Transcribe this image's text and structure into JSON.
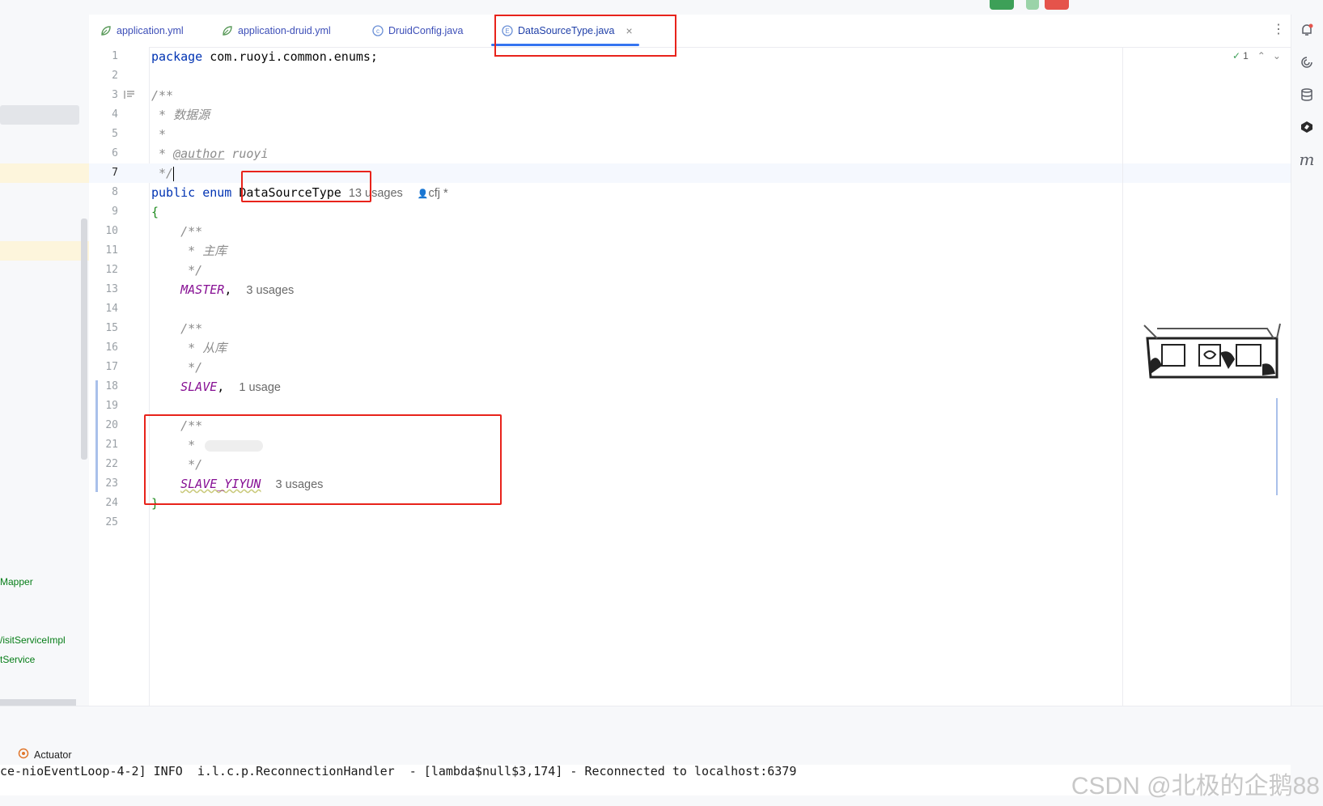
{
  "tabs": [
    {
      "label": "application.yml",
      "icon": "yaml-leaf-icon"
    },
    {
      "label": "application-druid.yml",
      "icon": "yaml-leaf-icon"
    },
    {
      "label": "DruidConfig.java",
      "icon": "class-icon"
    },
    {
      "label": "DataSourceType.java",
      "icon": "enum-icon",
      "active": true,
      "close": "×"
    }
  ],
  "project_tree": [
    "Mapper",
    "/isitServiceImpl",
    "tService"
  ],
  "line_numbers": [
    "1",
    "2",
    "3",
    "4",
    "5",
    "6",
    "7",
    "8",
    "9",
    "10",
    "11",
    "12",
    "13",
    "14",
    "15",
    "16",
    "17",
    "18",
    "19",
    "20",
    "21",
    "22",
    "23",
    "24",
    "25"
  ],
  "code": {
    "l1_kw": "package",
    "l1_rest": " com.ruoyi.common.enums;",
    "l3": "/**",
    "l4": " * 数据源",
    "l5": " *",
    "l6_a": " * ",
    "l6_tag": "@author",
    "l6_b": " ruoyi",
    "l7": " */",
    "l8_kw": "public enum",
    "l8_name": "DataSourceType",
    "l8_hint": "13 usages",
    "l8_author": "cfj *",
    "l9": "{",
    "l10": "    /**",
    "l11": "     * 主库",
    "l12": "     */",
    "l13_const": "MASTER",
    "l13_punct": ",",
    "l13_hint": "3 usages",
    "l15": "    /**",
    "l16": "     * 从库",
    "l17": "     */",
    "l18_const": "SLAVE",
    "l18_punct": ",",
    "l18_hint": "1 usage",
    "l20": "    /**",
    "l21": "     *",
    "l22": "     */",
    "l23_const": "SLAVE_YIYUN",
    "l23_hint": "3 usages",
    "l24": "}"
  },
  "inspection": {
    "count": "1"
  },
  "bottom": {
    "actuator_label": "Actuator",
    "console_line": "ce-nioEventLoop-4-2] INFO  i.l.c.p.ReconnectionHandler  - [lambda$null$3,174] - Reconnected to localhost:6379"
  },
  "watermark": "CSDN @北极的企鹅88",
  "colors": {
    "keyword": "#0033b3",
    "enum_constant": "#871094",
    "comment": "#8c8c8c",
    "highlight_box": "#e8231b",
    "tab_underline": "#3574f0"
  }
}
